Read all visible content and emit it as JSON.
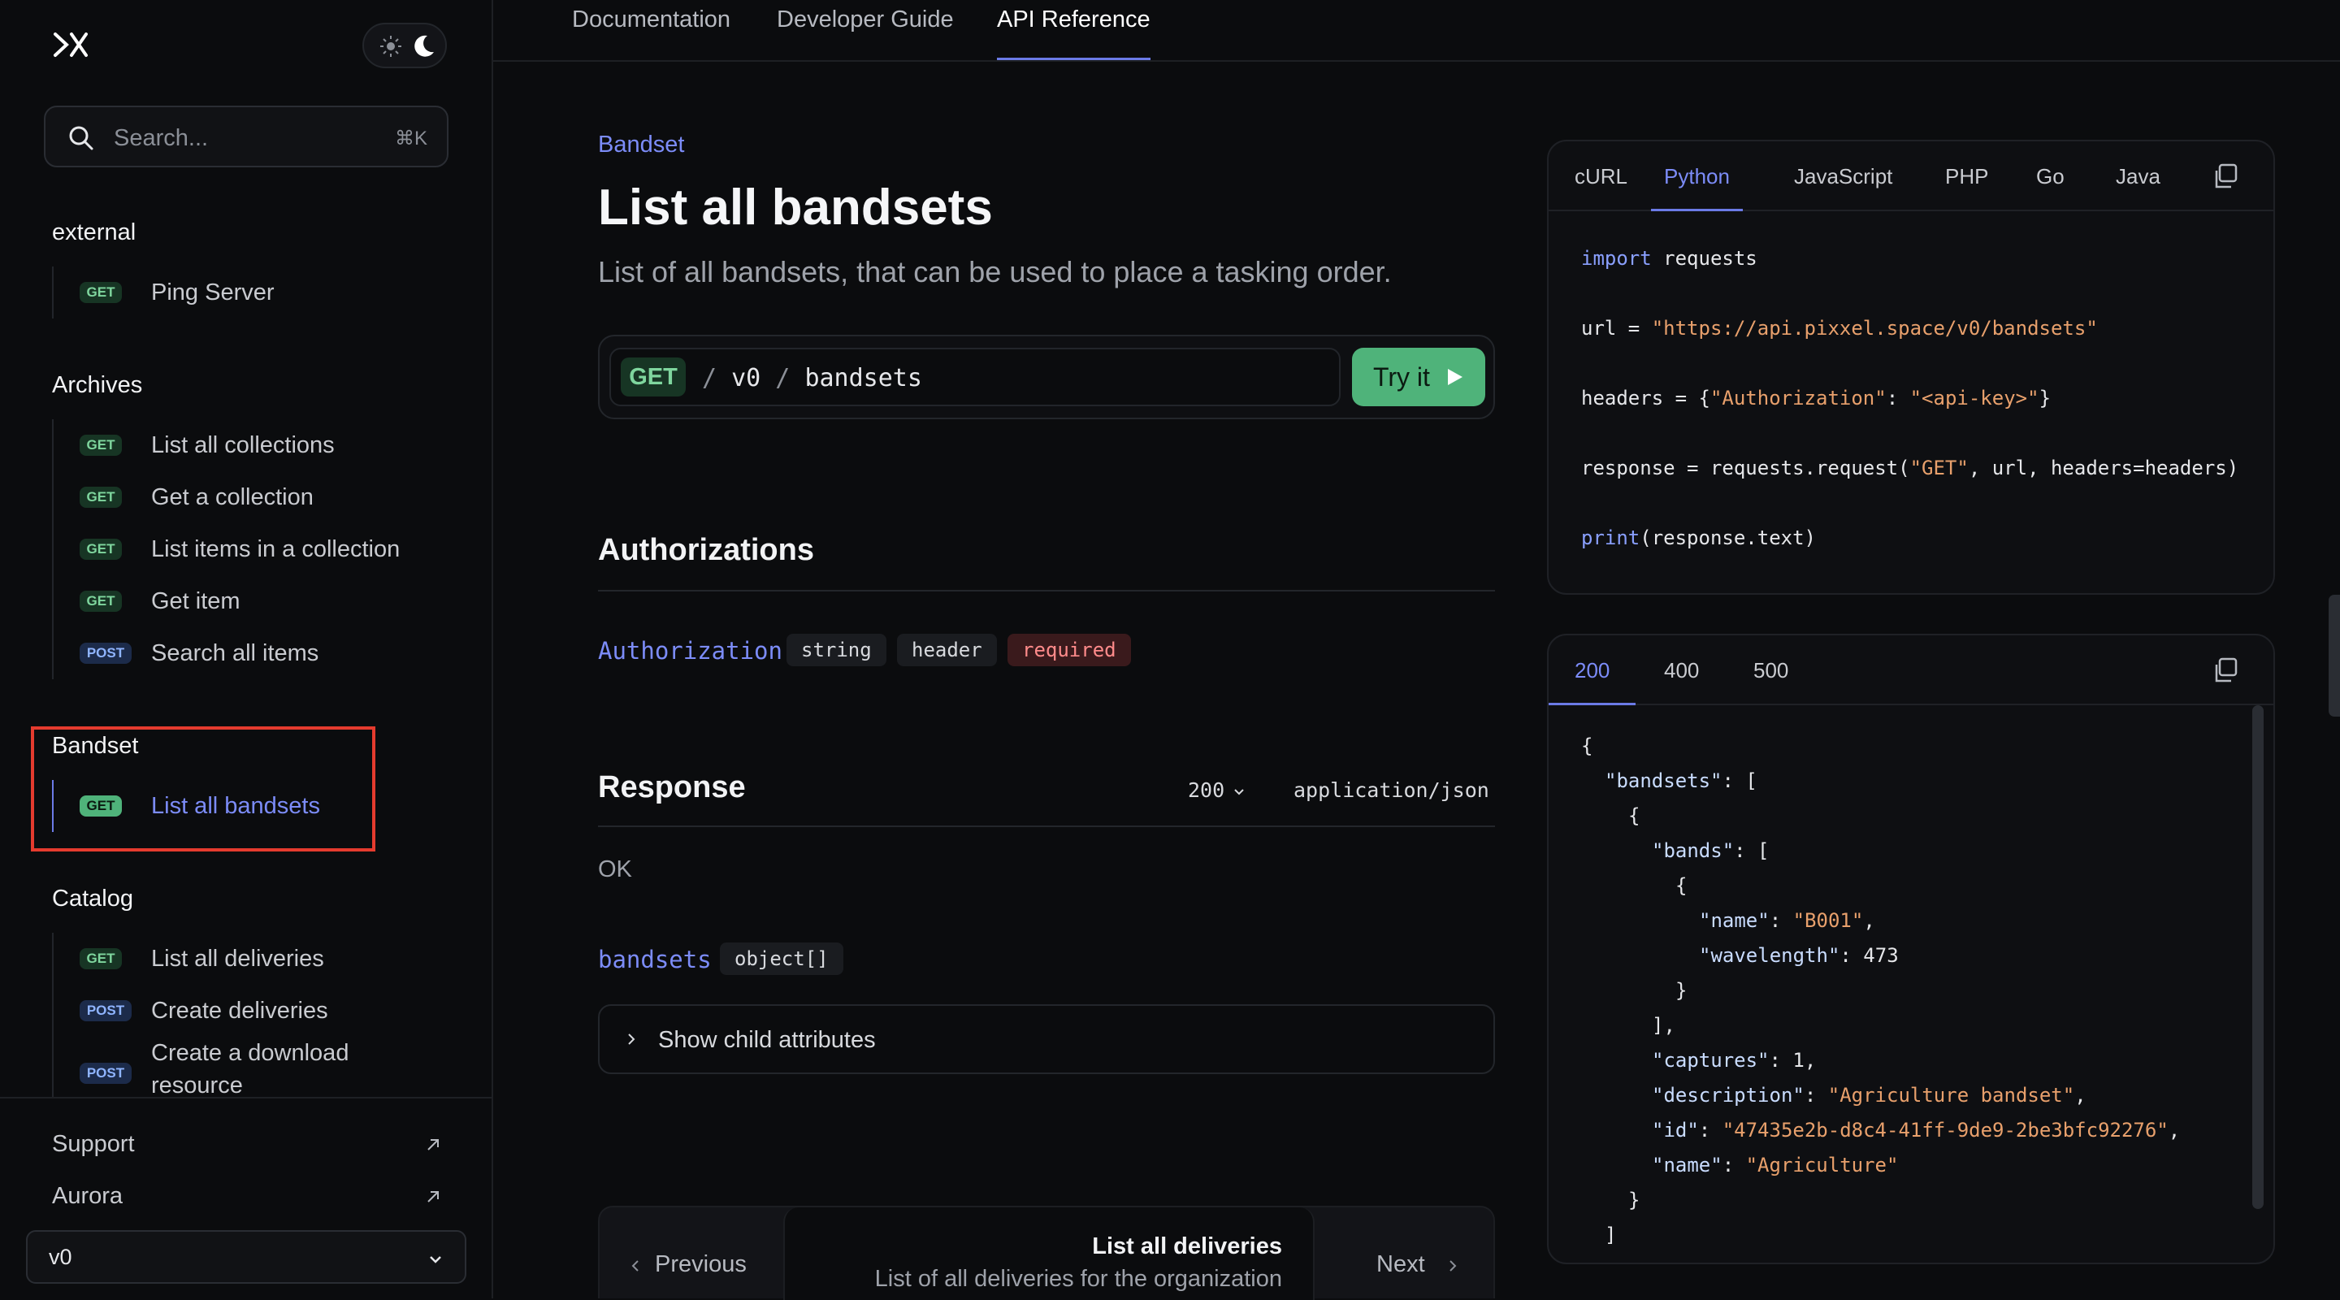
{
  "sidebar": {
    "search": {
      "placeholder": "Search...",
      "shortcut": "⌘K"
    },
    "groups": [
      {
        "title": "external",
        "items": [
          {
            "method": "GET",
            "label": "Ping Server"
          }
        ]
      },
      {
        "title": "Archives",
        "items": [
          {
            "method": "GET",
            "label": "List all collections"
          },
          {
            "method": "GET",
            "label": "Get a collection"
          },
          {
            "method": "GET",
            "label": "List items in a collection"
          },
          {
            "method": "GET",
            "label": "Get item"
          },
          {
            "method": "POST",
            "label": "Search all items"
          }
        ]
      },
      {
        "title": "Bandset",
        "items": [
          {
            "method": "GET",
            "label": "List all bandsets",
            "active": true
          }
        ]
      },
      {
        "title": "Catalog",
        "items": [
          {
            "method": "GET",
            "label": "List all deliveries"
          },
          {
            "method": "POST",
            "label": "Create deliveries"
          },
          {
            "method": "POST",
            "label": "Create a download resource"
          }
        ]
      }
    ],
    "footer": {
      "links": [
        {
          "label": "Support",
          "icon": "external-arrow-icon"
        },
        {
          "label": "Aurora",
          "icon": "external-arrow-icon"
        }
      ],
      "version": "v0"
    }
  },
  "topnav": {
    "tabs": [
      {
        "label": "Documentation"
      },
      {
        "label": "Developer Guide"
      },
      {
        "label": "API Reference",
        "active": true
      }
    ]
  },
  "main": {
    "breadcrumb": "Bandset",
    "title": "List all bandsets",
    "subtitle": "List of all bandsets, that can be used to place a tasking order.",
    "endpoint": {
      "method": "GET",
      "path_segments": [
        "v0",
        "bandsets"
      ],
      "try_label": "Try it"
    },
    "authorizations": {
      "title": "Authorizations",
      "param": {
        "name": "Authorization",
        "type": "string",
        "location": "header",
        "required": "required"
      }
    },
    "response": {
      "title": "Response",
      "status": "200",
      "content_type": "application/json",
      "description": "OK",
      "field": {
        "name": "bandsets",
        "type": "object[]"
      },
      "child_toggle": "Show child attributes"
    },
    "pager": {
      "previous": "Previous",
      "next_title": "List all deliveries",
      "next_desc": "List of all deliveries for the organization",
      "next": "Next"
    }
  },
  "request_example": {
    "tabs": [
      "cURL",
      "Python",
      "JavaScript",
      "PHP",
      "Go",
      "Java"
    ],
    "active_tab": "Python",
    "code": {
      "l1_kw": "import",
      "l1_rest": " requests",
      "l2_a": "url = ",
      "l2_str": "\"https://api.pixxel.space/v0/bandsets\"",
      "l3_a": "headers = {",
      "l3_k": "\"Authorization\"",
      "l3_b": ": ",
      "l3_v": "\"<api-key>\"",
      "l3_c": "}",
      "l4_a": "response = requests.request(",
      "l4_s": "\"GET\"",
      "l4_b": ", url, headers=headers)",
      "l5_kw": "print",
      "l5_rest": "(response.text)"
    }
  },
  "response_example": {
    "tabs": [
      "200",
      "400",
      "500"
    ],
    "active_tab": "200",
    "lines": [
      {
        "indent": 0,
        "text": "{"
      },
      {
        "indent": 1,
        "key": "\"bandsets\"",
        "rest": ": ["
      },
      {
        "indent": 2,
        "text": "{"
      },
      {
        "indent": 3,
        "key": "\"bands\"",
        "rest": ": ["
      },
      {
        "indent": 4,
        "text": "{"
      },
      {
        "indent": 5,
        "key": "\"name\"",
        "rest": ": ",
        "str": "\"B001\"",
        "tail": ","
      },
      {
        "indent": 5,
        "key": "\"wavelength\"",
        "rest": ": 473"
      },
      {
        "indent": 4,
        "text": "}"
      },
      {
        "indent": 3,
        "text": "],"
      },
      {
        "indent": 3,
        "key": "\"captures\"",
        "rest": ": 1,"
      },
      {
        "indent": 3,
        "key": "\"description\"",
        "rest": ": ",
        "str": "\"Agriculture bandset\"",
        "tail": ","
      },
      {
        "indent": 3,
        "key": "\"id\"",
        "rest": ": ",
        "str": "\"47435e2b-d8c4-41ff-9de9-2be3bfc92276\"",
        "tail": ","
      },
      {
        "indent": 3,
        "key": "\"name\"",
        "rest": ": ",
        "str": "\"Agriculture\""
      },
      {
        "indent": 2,
        "text": "}"
      },
      {
        "indent": 1,
        "text": "]"
      }
    ]
  },
  "colors": {
    "accent": "#7c8cf8",
    "get_badge": "#173524",
    "post_badge": "#1c2b4a",
    "try_button": "#4fb37a",
    "highlight": "#e53b2e"
  }
}
